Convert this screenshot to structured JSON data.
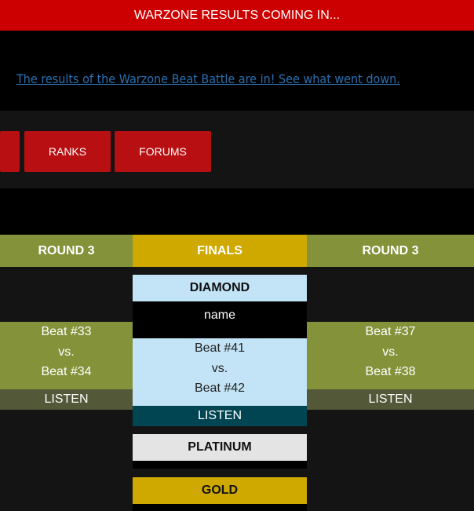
{
  "topbar": {
    "text": "WARZONE RESULTS COMING IN..."
  },
  "announcement": {
    "link_text": "The results of the Warzone Beat Battle are in! See what went down."
  },
  "nav": {
    "items": [
      {
        "label": ""
      },
      {
        "label": "RANKS"
      },
      {
        "label": "FORUMS"
      }
    ]
  },
  "bracket": {
    "left": {
      "header": "ROUND 3",
      "match": {
        "beat_a": "Beat #33",
        "vs": "vs.",
        "beat_b": "Beat #34"
      },
      "listen": "LISTEN"
    },
    "finals": {
      "header": "FINALS",
      "diamond": {
        "label": "DIAMOND",
        "name": "name"
      },
      "match": {
        "beat_a": "Beat #41",
        "vs": "vs.",
        "beat_b": "Beat #42"
      },
      "listen": "LISTEN",
      "platinum": {
        "label": "PLATINUM"
      },
      "gold": {
        "label": "GOLD"
      }
    },
    "right": {
      "header": "ROUND 3",
      "match": {
        "beat_a": "Beat #37",
        "vs": "vs.",
        "beat_b": "Beat #38"
      },
      "listen": "LISTEN"
    }
  },
  "colors": {
    "topbar": "#cc0000",
    "nav_button": "#b81012",
    "olive": "#84923a",
    "gold": "#cfa800",
    "diamond": "#c2e4f6",
    "teal": "#024552",
    "link": "#2a6fb0"
  }
}
